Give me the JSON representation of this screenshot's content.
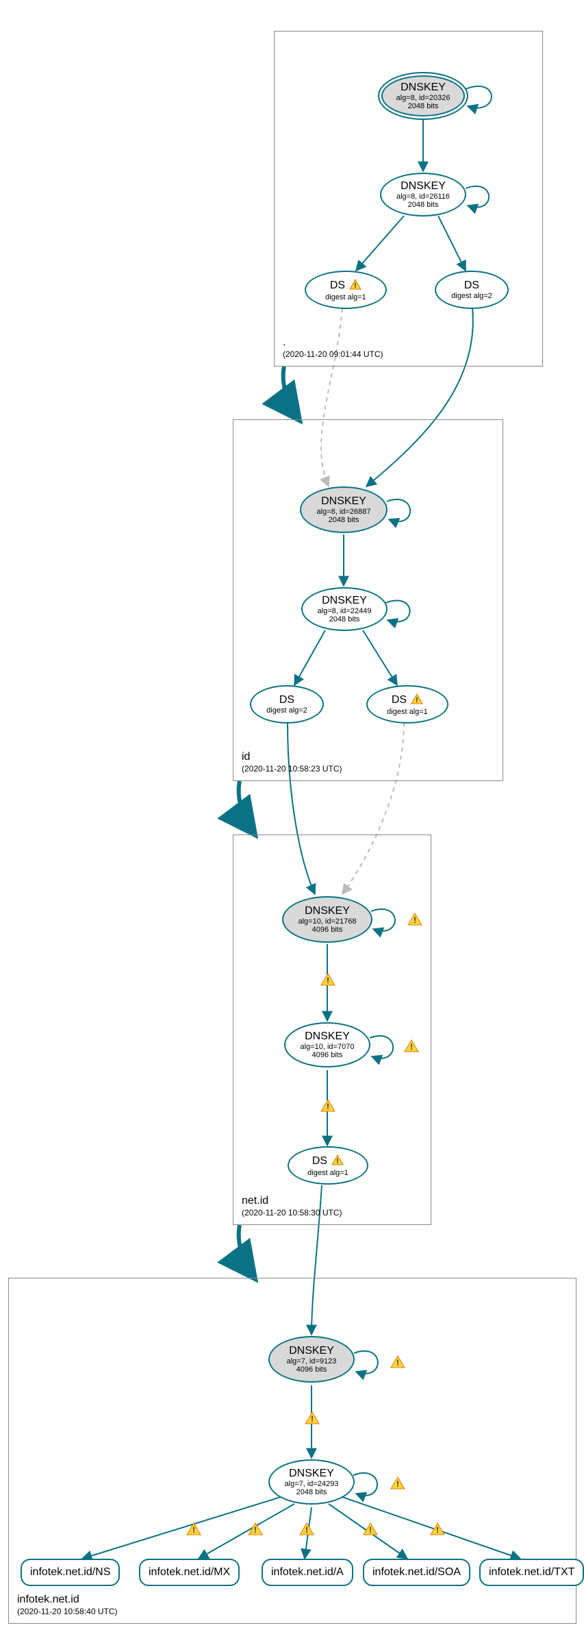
{
  "colors": {
    "stroke": "#0b7285",
    "ksk_fill": "#d9d9d9",
    "warn_fill": "#ffd43b",
    "warn_stroke": "#e67700"
  },
  "zones": [
    {
      "name": ".",
      "timestamp": "(2020-11-20 09:01:44 UTC)"
    },
    {
      "name": "id",
      "timestamp": "(2020-11-20 10:58:23 UTC)"
    },
    {
      "name": "net.id",
      "timestamp": "(2020-11-20 10:58:30 UTC)"
    },
    {
      "name": "infotek.net.id",
      "timestamp": "(2020-11-20 10:58:40 UTC)"
    }
  ],
  "nodes": {
    "root_ksk": {
      "title": "DNSKEY",
      "line2": "alg=8, id=20326",
      "line3": "2048 bits"
    },
    "root_zsk": {
      "title": "DNSKEY",
      "line2": "alg=8, id=26116",
      "line3": "2048 bits"
    },
    "root_ds1": {
      "title": "DS",
      "line2": "digest alg=1",
      "warn": true
    },
    "root_ds2": {
      "title": "DS",
      "line2": "digest alg=2"
    },
    "id_ksk": {
      "title": "DNSKEY",
      "line2": "alg=8, id=26887",
      "line3": "2048 bits"
    },
    "id_zsk": {
      "title": "DNSKEY",
      "line2": "alg=8, id=22449",
      "line3": "2048 bits"
    },
    "id_ds2": {
      "title": "DS",
      "line2": "digest alg=2"
    },
    "id_ds1": {
      "title": "DS",
      "line2": "digest alg=1",
      "warn": true
    },
    "net_ksk": {
      "title": "DNSKEY",
      "line2": "alg=10, id=21768",
      "line3": "4096 bits"
    },
    "net_zsk": {
      "title": "DNSKEY",
      "line2": "alg=10, id=7070",
      "line3": "4096 bits"
    },
    "net_ds1": {
      "title": "DS",
      "line2": "digest alg=1",
      "warn": true
    },
    "inf_ksk": {
      "title": "DNSKEY",
      "line2": "alg=7, id=9123",
      "line3": "4096 bits"
    },
    "inf_zsk": {
      "title": "DNSKEY",
      "line2": "alg=7, id=24293",
      "line3": "2048 bits"
    }
  },
  "rrsets": [
    {
      "label": "infotek.net.id/NS"
    },
    {
      "label": "infotek.net.id/MX"
    },
    {
      "label": "infotek.net.id/A"
    },
    {
      "label": "infotek.net.id/SOA"
    },
    {
      "label": "infotek.net.id/TXT"
    }
  ]
}
